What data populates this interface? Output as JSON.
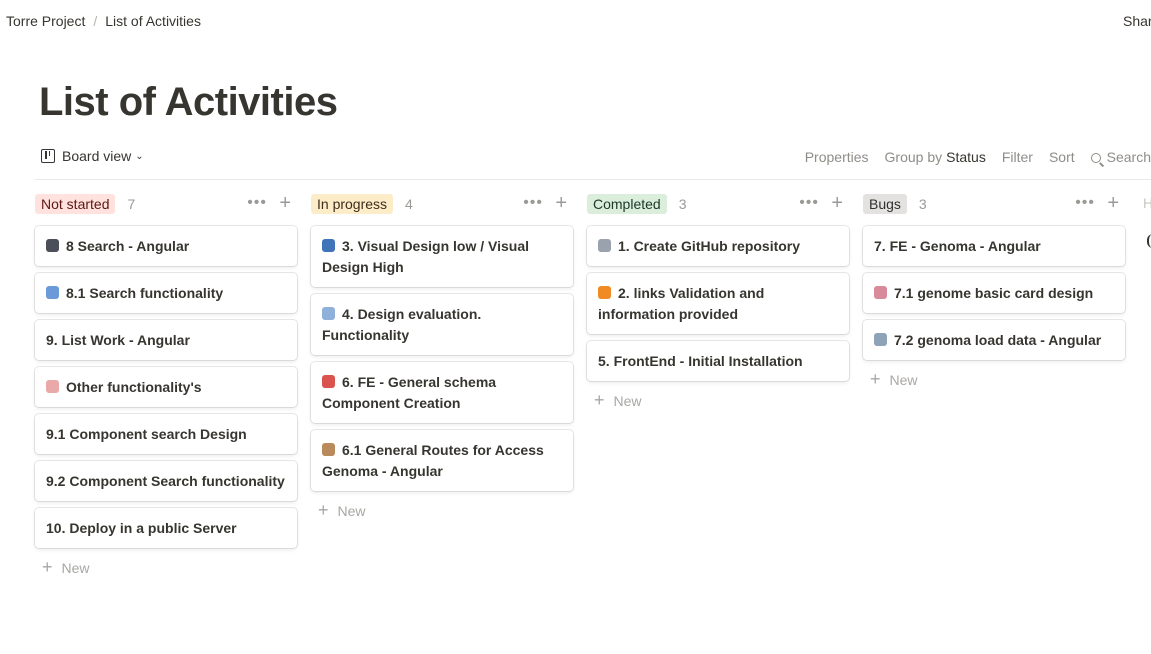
{
  "breadcrumb": {
    "root": "Torre Project",
    "separator": "/",
    "current": "List of Activities"
  },
  "share_label": "Shar",
  "page_title": "List of Activities",
  "view": {
    "name": "Board view",
    "actions": {
      "properties": "Properties",
      "group_by_label": "Group by",
      "group_by_value": "Status",
      "filter": "Filter",
      "sort": "Sort",
      "search": "Search"
    }
  },
  "new_label": "New",
  "columns": [
    {
      "name": "Not started",
      "count": "7",
      "badge_bg": "#ffe2dd",
      "badge_color": "#5d1715",
      "cards": [
        {
          "icon": "camera-icon",
          "glyph": "📷",
          "color": "#4b4f59",
          "title": "8 Search - Angular"
        },
        {
          "icon": "magnifier-icon",
          "glyph": "🔎",
          "color": "#6a9bd8",
          "title": "8.1 Search functionality"
        },
        {
          "icon": "",
          "glyph": "",
          "color": "",
          "title": "9. List Work - Angular"
        },
        {
          "icon": "baseball-icon",
          "glyph": "⚾",
          "color": "#e9a9a9",
          "title": "Other functionality's"
        },
        {
          "icon": "",
          "glyph": "",
          "color": "",
          "title": "9.1 Component search Design"
        },
        {
          "icon": "",
          "glyph": "",
          "color": "",
          "title": "9.2 Component Search functionality"
        },
        {
          "icon": "",
          "glyph": "",
          "color": "",
          "title": "10. Deploy in a public Server"
        }
      ]
    },
    {
      "name": "In progress",
      "count": "4",
      "badge_bg": "#fdecc8",
      "badge_color": "#402c1b",
      "cards": [
        {
          "icon": "television-icon",
          "glyph": "📺",
          "color": "#3f74b8",
          "title": "3. Visual Design low / Visual Design High"
        },
        {
          "icon": "clock-icon",
          "glyph": "🕓",
          "color": "#8fb1d9",
          "title": "4. Design evaluation. Functionality"
        },
        {
          "icon": "paintbrush-icon",
          "glyph": "🖌",
          "color": "#d9534f",
          "title": "6. FE - General schema Component Creation"
        },
        {
          "icon": "person-icon",
          "glyph": "👨",
          "color": "#b88a5c",
          "title": "6.1 General Routes for Access Genoma - Angular"
        }
      ]
    },
    {
      "name": "Completed",
      "count": "3",
      "badge_bg": "#dbeddb",
      "badge_color": "#1c3829",
      "cards": [
        {
          "icon": "notepad-icon",
          "glyph": "🗒",
          "color": "#9aa3ad",
          "title": "1. Create GitHub repository"
        },
        {
          "icon": "fire-icon",
          "glyph": "🔥",
          "color": "#f08a24",
          "title": "2. links Validation and information provided"
        },
        {
          "icon": "",
          "glyph": "",
          "color": "",
          "title": "5. FrontEnd - Initial Installation"
        }
      ]
    },
    {
      "name": "Bugs",
      "count": "3",
      "badge_bg": "#e3e2e0",
      "badge_color": "#32302c",
      "cards": [
        {
          "icon": "",
          "glyph": "",
          "color": "",
          "title": "7. FE - Genoma - Angular"
        },
        {
          "icon": "book-icon",
          "glyph": "📖",
          "color": "#d98a9a",
          "title": "7.1 genome basic card design"
        },
        {
          "icon": "wand-icon",
          "glyph": "🔧",
          "color": "#8fa3b8",
          "title": "7.2 genoma load data - Angular"
        }
      ]
    }
  ],
  "next_column_hint": "H"
}
